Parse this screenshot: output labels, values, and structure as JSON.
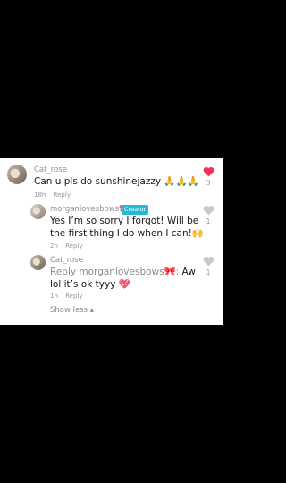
{
  "comments": [
    {
      "username": "Cat_rose",
      "text": "Can u pls do sunshinejazzy 🙏🙏🙏",
      "time": "18h",
      "reply_label": "Reply",
      "likes": "3",
      "liked": true
    },
    {
      "username": "morganlovesbows🎀",
      "creator_label": "Creator",
      "text": "Yes I’m so sorry I forgot! Will be the first thing I do when I can!🙌",
      "time": "2h",
      "reply_label": "Reply",
      "likes": "1",
      "liked": false
    },
    {
      "username": "Cat_rose",
      "mention": "Reply morganlovesbows🎀:",
      "text": " Aw lol it’s ok tyyy 💖",
      "time": "1h",
      "reply_label": "Reply",
      "likes": "1",
      "liked": false
    }
  ],
  "show_less": "Show less ▴",
  "colors": {
    "liked_heart": "#ff2b55",
    "unliked_heart": "#c9c9c9",
    "creator_badge": "#27b8d9"
  }
}
